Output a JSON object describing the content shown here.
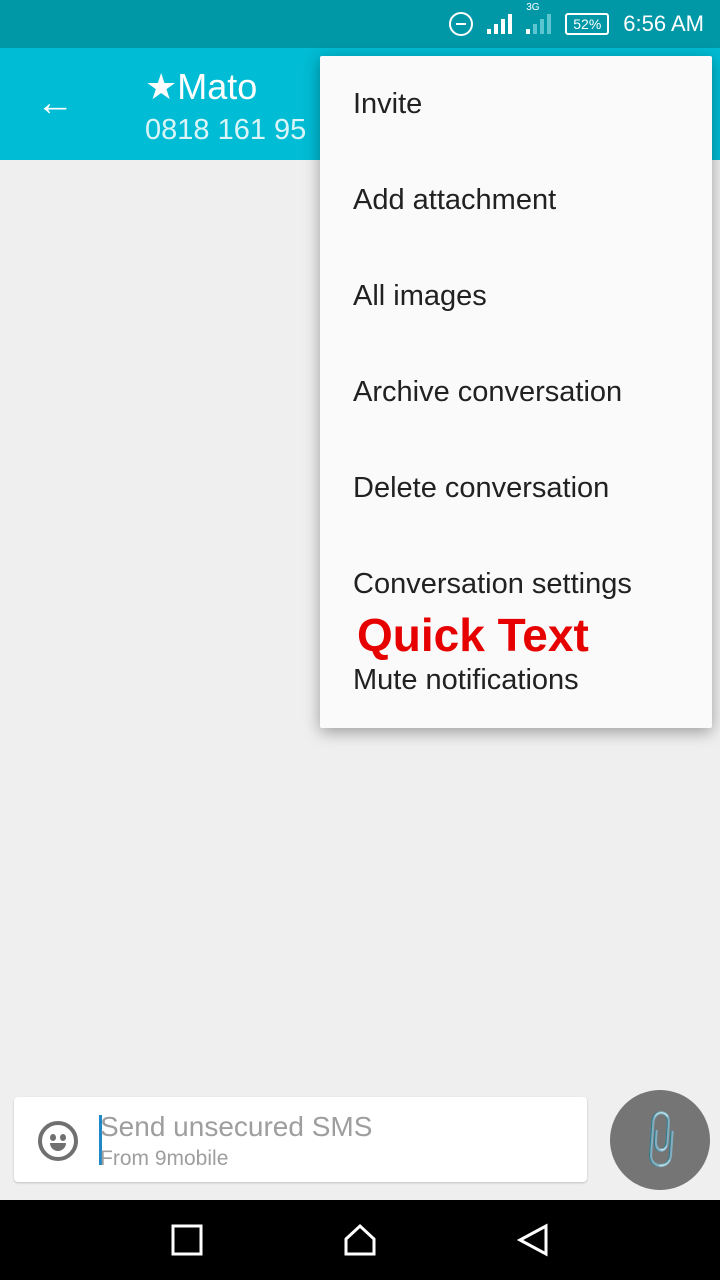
{
  "status_bar": {
    "battery": "52%",
    "time": "6:56 AM",
    "network": "3G",
    "icons": [
      "do-not-disturb-icon",
      "signal-icon",
      "signal-3g-icon",
      "battery-icon"
    ]
  },
  "app_bar": {
    "title": "★Mato",
    "subtitle": "0818 161 95",
    "back_icon": "arrow-left-icon"
  },
  "menu": {
    "items": [
      "Invite",
      "Add attachment",
      "All images",
      "Archive conversation",
      "Delete conversation",
      "Conversation settings",
      "Mute notifications"
    ],
    "overlay_label": "Quick Text"
  },
  "compose": {
    "placeholder": "Send unsecured SMS",
    "sim_label": "From 9mobile",
    "emoji_icon": "smiley-icon",
    "attach_icon": "paperclip-icon"
  },
  "colors": {
    "status_bar": "#0097a7",
    "app_bar": "#00bcd4",
    "overlay_label": "#e60000",
    "fab": "#757575"
  }
}
